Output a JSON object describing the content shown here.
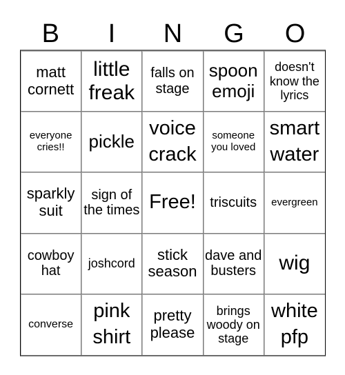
{
  "header": {
    "letters": [
      "B",
      "I",
      "N",
      "G",
      "O"
    ]
  },
  "cells": [
    [
      "matt cornett",
      "little freak",
      "falls on stage",
      "spoon emoji",
      "doesn't know the lyrics"
    ],
    [
      "everyone cries!!",
      "pickle",
      "voice crack",
      "someone you loved",
      "smart water"
    ],
    [
      "sparkly suit",
      "sign of the times",
      "Free!",
      "triscuits",
      "evergreen"
    ],
    [
      "cowboy hat",
      "joshcord",
      "stick season",
      "dave and busters",
      "wig"
    ],
    [
      "converse",
      "pink shirt",
      "pretty please",
      "brings woody on stage",
      "white pfp"
    ]
  ],
  "free_space": {
    "row": 2,
    "col": 2,
    "label": "Free!"
  }
}
